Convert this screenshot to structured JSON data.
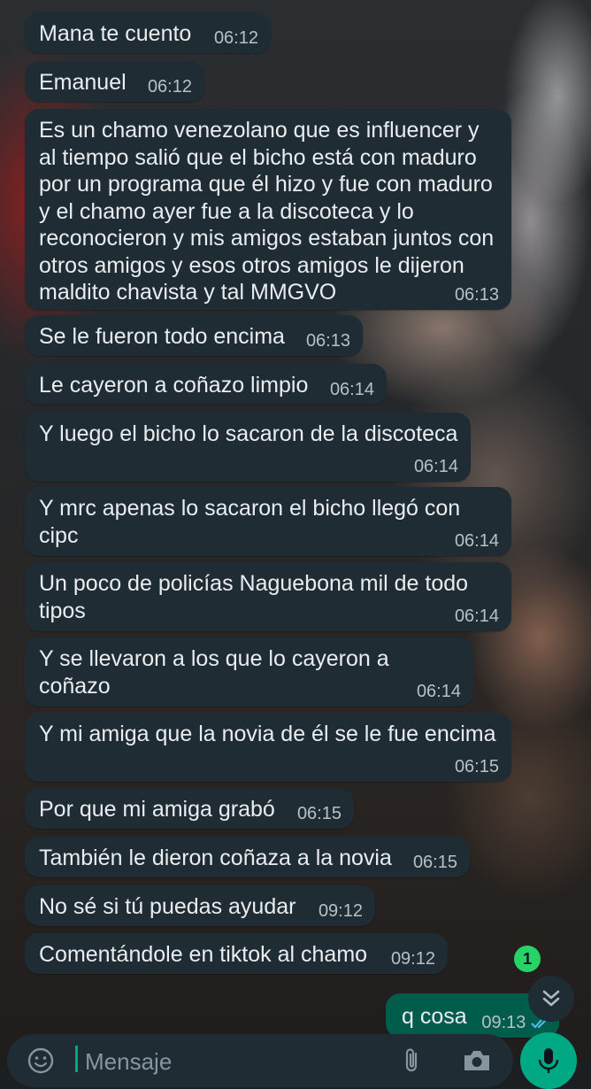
{
  "chat": {
    "messages": [
      {
        "text": "Mana te cuento",
        "time": "06:12"
      },
      {
        "text": "Emanuel",
        "time": "06:12"
      },
      {
        "text": "Es un chamo venezolano que es influencer y\nal tiempo salió que el bicho está con maduro\npor un programa que él hizo y fue con maduro\ny el chamo ayer fue a la discoteca y lo\nreconocieron y mis amigos estaban juntos con\notros amigos y esos otros amigos le dijeron\nmaldito chavista y tal MMGVO",
        "time": "06:13"
      },
      {
        "text": "Se le fueron todo encima",
        "time": "06:13"
      },
      {
        "text": "Le cayeron a coñazo limpio",
        "time": "06:14"
      },
      {
        "text": "Y luego el bicho lo sacaron de la discoteca",
        "time": "06:14"
      },
      {
        "text": "Y mrc apenas lo sacaron el bicho llegó con\ncipc",
        "time": "06:14"
      },
      {
        "text": "Un poco de policías Naguebona mil de todo\ntipos",
        "time": "06:14"
      },
      {
        "text": "Y se llevaron a los que lo cayeron a coñazo",
        "time": "06:14"
      },
      {
        "text": "Y mi amiga que la novia de él se le fue encima",
        "time": "06:15"
      },
      {
        "text": "Por que mi amiga grabó",
        "time": "06:15"
      },
      {
        "text": "También le dieron coñaza a la novia",
        "time": "06:15"
      },
      {
        "text": "No sé si tú puedas ayudar",
        "time": "09:12"
      },
      {
        "text": "Comentándole en tiktok al chamo",
        "time": "09:12"
      }
    ],
    "outgoing": {
      "text": "q cosa",
      "time": "09:13",
      "status_icon": "double-check-icon"
    },
    "unread_badge": "1",
    "scroll_down_icon": "double-chevron-down-icon"
  },
  "composer": {
    "placeholder": "Mensaje",
    "emoji_icon": "emoji-icon",
    "attach_icon": "paperclip-icon",
    "camera_icon": "camera-icon",
    "mic_icon": "mic-icon"
  },
  "colors": {
    "incoming_bubble": "#1f2c34",
    "outgoing_bubble": "#005c4b",
    "accent": "#00a884",
    "badge": "#25d366",
    "text": "#e9edef",
    "timestamp": "#b8c0c4"
  }
}
